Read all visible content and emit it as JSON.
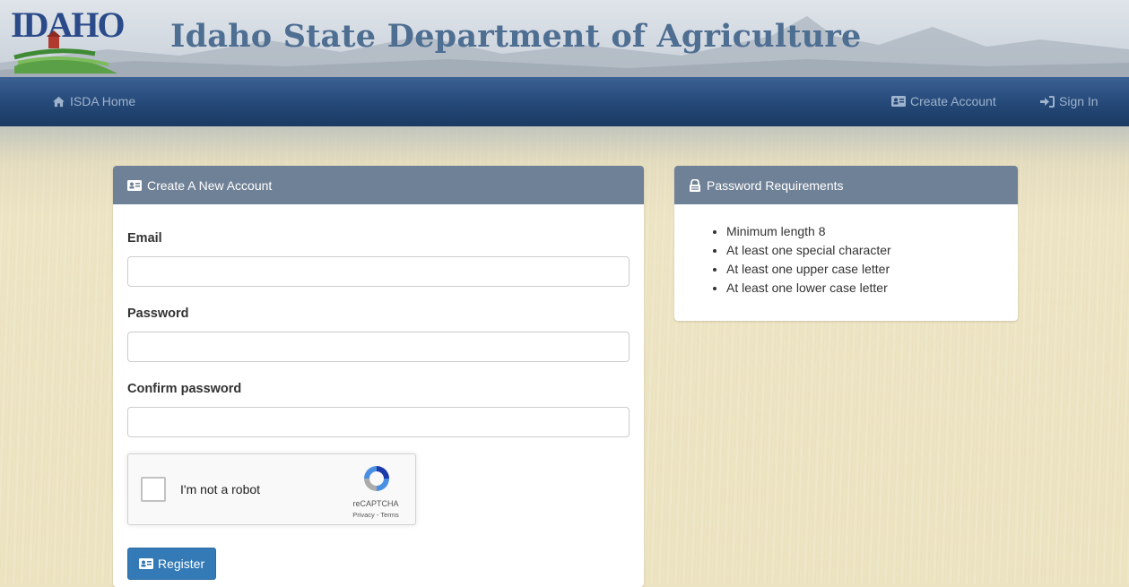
{
  "header": {
    "logo_text": "IDAHO",
    "site_title": "Idaho State Department of Agriculture"
  },
  "nav": {
    "home_label": "ISDA Home",
    "create_account_label": "Create Account",
    "sign_in_label": "Sign In"
  },
  "create_panel": {
    "heading": "Create A New Account",
    "email_label": "Email",
    "email_value": "",
    "password_label": "Password",
    "password_value": "",
    "confirm_label": "Confirm password",
    "confirm_value": "",
    "recaptcha": {
      "label": "I'm not a robot",
      "brand": "reCAPTCHA",
      "links": "Privacy - Terms",
      "checked": false
    },
    "register_label": "Register"
  },
  "requirements_panel": {
    "heading": "Password Requirements",
    "items": [
      "Minimum length 8",
      "At least one special character",
      "At least one upper case letter",
      "At least one lower case letter"
    ]
  },
  "colors": {
    "nav_bg": "#244877",
    "panel_heading_bg": "#6f8196",
    "button_primary": "#337ab7",
    "title_text": "#4e6e92"
  },
  "icons": {
    "home": "home-icon",
    "id_card": "id-card-icon",
    "sign_in": "sign-in-icon",
    "requirements": "lock-icon",
    "recaptcha": "recaptcha-logo-icon"
  }
}
